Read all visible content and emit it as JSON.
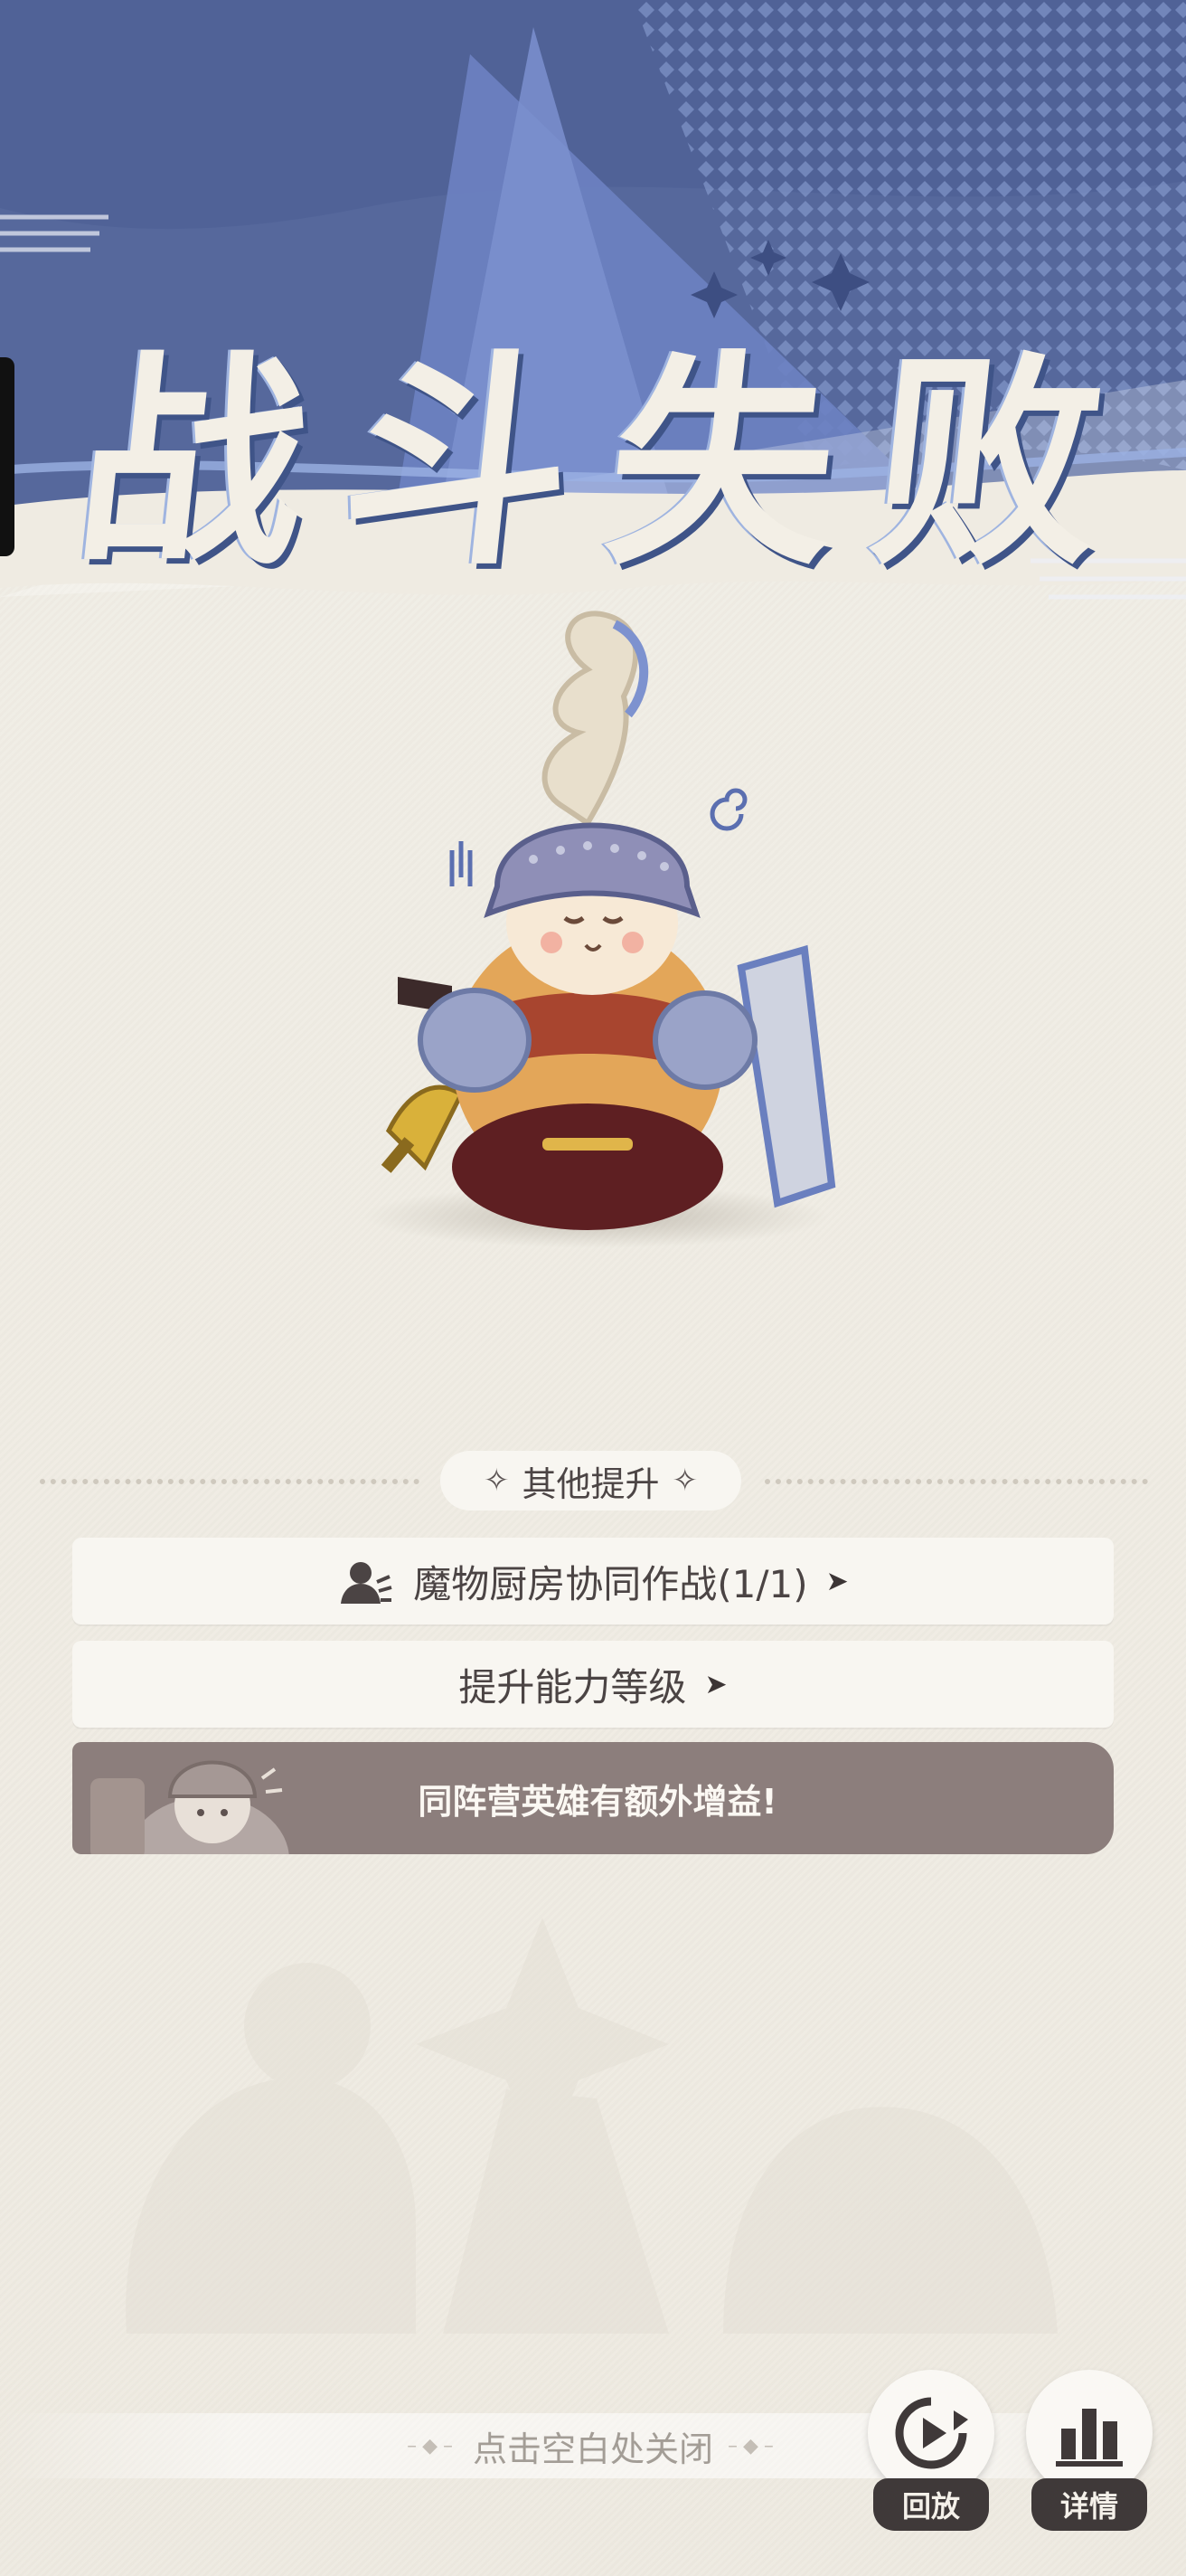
{
  "result": {
    "title_chars": [
      "战",
      "斗",
      "失",
      "败"
    ]
  },
  "section": {
    "label": "其他提升"
  },
  "items": [
    {
      "icon": "coop-battle-icon",
      "label": "魔物厨房协同作战(1/1)",
      "arrow": "chevron-right-icon"
    },
    {
      "label": "提升能力等级",
      "arrow": "chevron-right-icon"
    }
  ],
  "banner": {
    "text": "同阵营英雄有额外增益!"
  },
  "footer": {
    "close_hint": "点击空白处关闭"
  },
  "buttons": {
    "replay_label": "回放",
    "details_label": "详情"
  },
  "colors": {
    "header_blue": "#5a6ea6",
    "header_dark": "#3f5488",
    "paper": "#efebe2",
    "banner": "#8c7e7c",
    "dark_label": "#3f3939"
  }
}
